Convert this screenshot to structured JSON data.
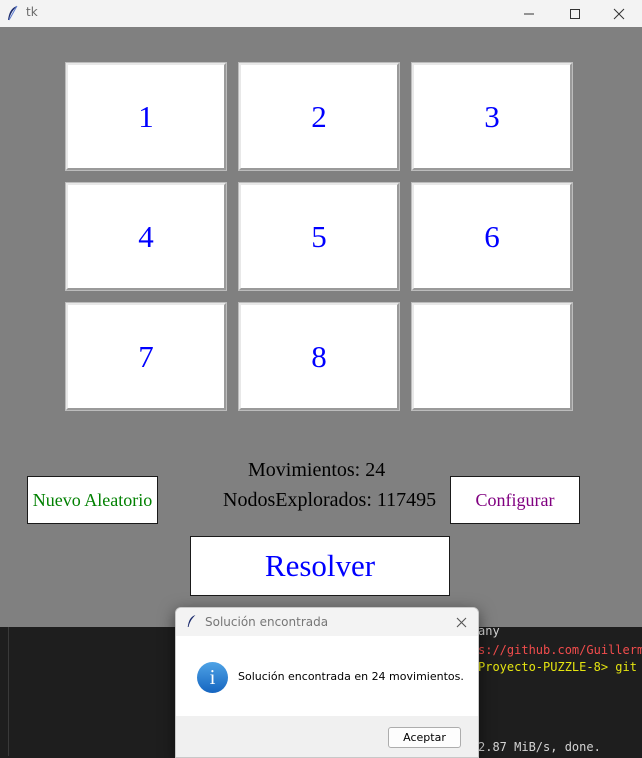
{
  "window": {
    "title": "tk"
  },
  "puzzle": {
    "tiles": [
      "1",
      "2",
      "3",
      "4",
      "5",
      "6",
      "7",
      "8",
      ""
    ]
  },
  "stats": {
    "moves_label": "Movimientos: 24",
    "nodes_label": "NodosExplorados: 117495"
  },
  "buttons": {
    "random": "Nuevo Aleatorio",
    "configure": "Configurar",
    "solve": "Resolver"
  },
  "terminal": {
    "lines": [
      "any",
      "s://github.com/Guillerm",
      "Proyecto-PUZZLE-8> git",
      "2.87 MiB/s, done."
    ]
  },
  "dialog": {
    "title": "Solución encontrada",
    "message": "Solución encontrada en 24 movimientos.",
    "ok_label": "Aceptar"
  },
  "colors": {
    "tile_text": "#0000ff",
    "random_text": "#008000",
    "configure_text": "#800080",
    "solve_text": "#0000ff",
    "background": "#808080"
  },
  "icons": {
    "app": "tk-feather-icon",
    "info": "info-icon"
  }
}
